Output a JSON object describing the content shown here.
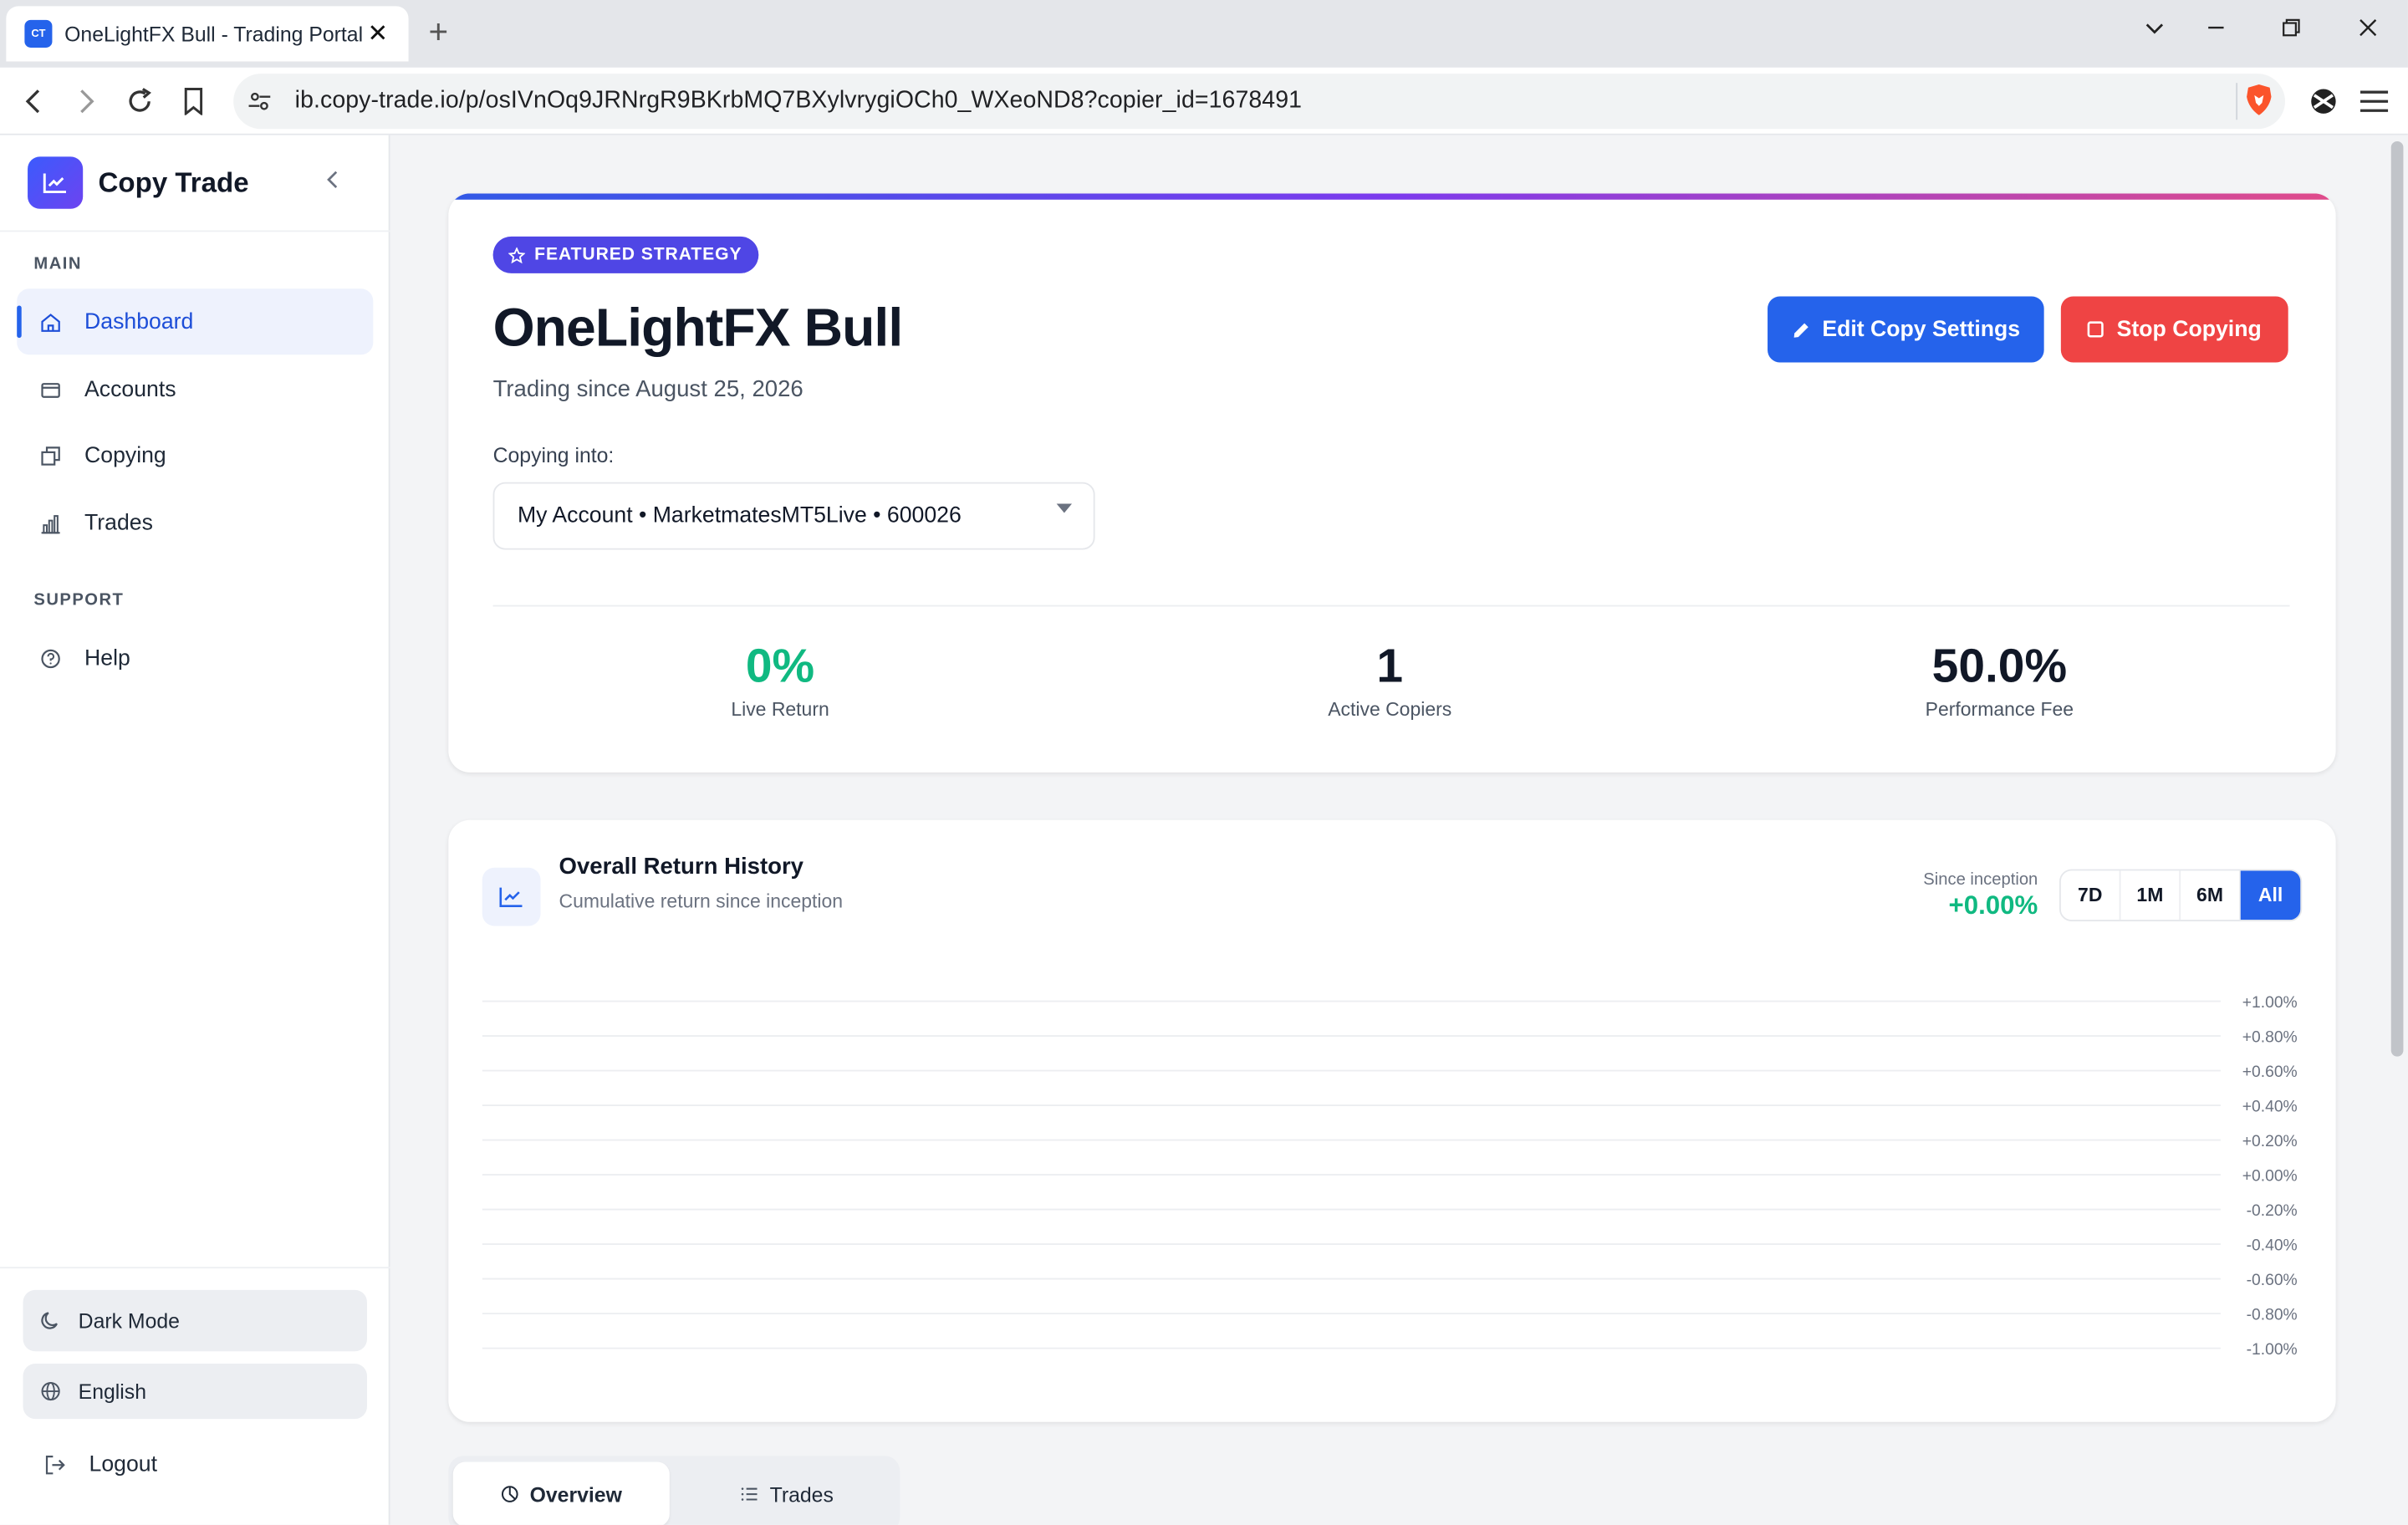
{
  "browser": {
    "tab_title": "OneLightFX Bull - Trading Portal",
    "tab_favicon_text": "CT",
    "url": "ib.copy-trade.io/p/osIVnOq9JRNrgR9BKrbMQ7BXylvrygiOCh0_WXeoND8?copier_id=1678491"
  },
  "sidebar": {
    "brand": "Copy Trade",
    "section_main": "MAIN",
    "items": [
      {
        "label": "Dashboard",
        "icon": "home-icon",
        "active": true
      },
      {
        "label": "Accounts",
        "icon": "wallet-icon"
      },
      {
        "label": "Copying",
        "icon": "copy-icon"
      },
      {
        "label": "Trades",
        "icon": "bar-chart-icon"
      }
    ],
    "section_support": "SUPPORT",
    "help": "Help",
    "dark_mode": "Dark Mode",
    "language": "English",
    "logout": "Logout"
  },
  "strategy": {
    "badge": "FEATURED STRATEGY",
    "name": "OneLightFX Bull",
    "since": "Trading since August 25, 2026",
    "edit_button": "Edit Copy Settings",
    "stop_button": "Stop Copying",
    "copying_into_label": "Copying into:",
    "copying_into_value": "My Account • MarketmatesMT5Live • 600026",
    "stats": [
      {
        "value": "0%",
        "label": "Live Return"
      },
      {
        "value": "1",
        "label": "Active Copiers"
      },
      {
        "value": "50.0%",
        "label": "Performance Fee"
      }
    ]
  },
  "return_history": {
    "title": "Overall Return History",
    "subtitle": "Cumulative return since inception",
    "since_label": "Since inception",
    "since_value": "+0.00%",
    "ranges": [
      "7D",
      "1M",
      "6M",
      "All"
    ],
    "active_range": "All"
  },
  "chart_data": {
    "type": "line",
    "title": "",
    "xlabel": "",
    "ylabel": "",
    "ylim": [
      -1.0,
      1.0
    ],
    "y_ticks": [
      "+1.00%",
      "+0.80%",
      "+0.60%",
      "+0.40%",
      "+0.20%",
      "+0.00%",
      "-0.20%",
      "-0.40%",
      "-0.60%",
      "-0.80%",
      "-1.00%"
    ],
    "series": [],
    "grid": true,
    "y_axis_side": "right"
  },
  "bottom_tabs": [
    {
      "label": "Overview",
      "icon": "pie-chart-icon",
      "active": true
    },
    {
      "label": "Trades",
      "icon": "list-icon"
    }
  ],
  "colors": {
    "primary": "#2563eb",
    "danger": "#ef4444",
    "positive": "#10b981",
    "badge": "#4f46e5"
  }
}
